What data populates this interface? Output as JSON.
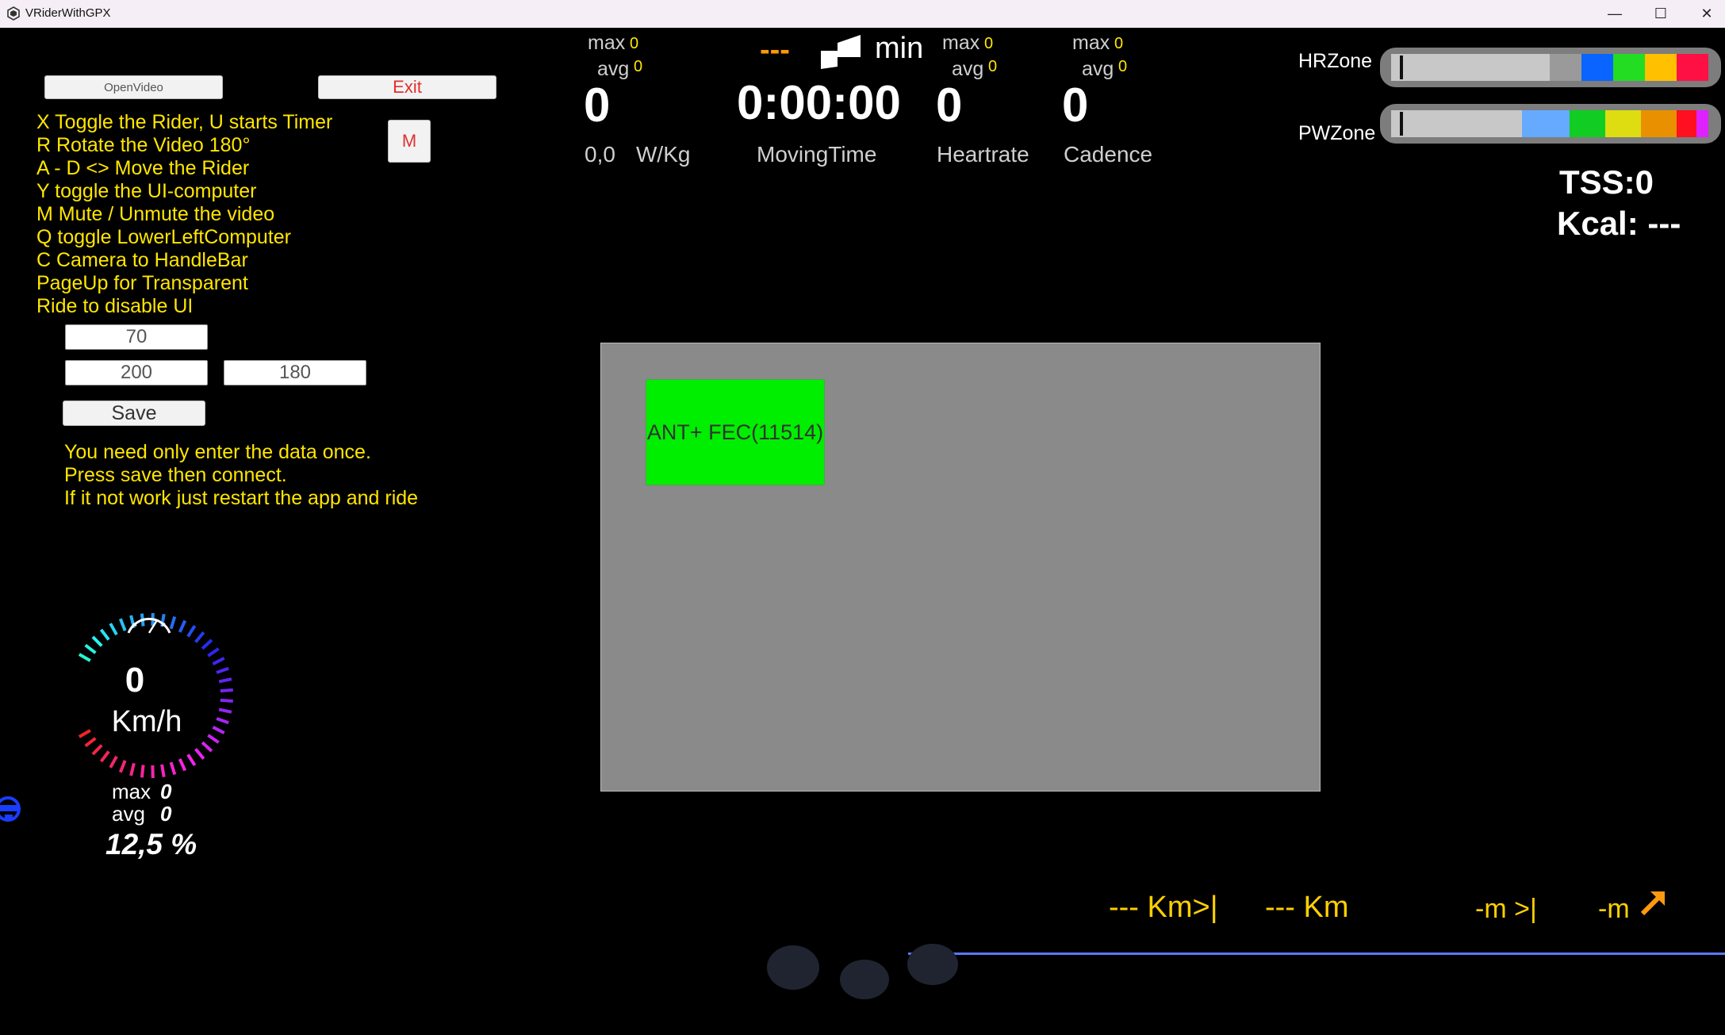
{
  "window": {
    "title": "VRiderWithGPX",
    "minimize_glyph": "—",
    "maximize_glyph": "☐",
    "close_glyph": "✕"
  },
  "controls": {
    "open_video_label": "OpenVideo",
    "exit_label": "Exit",
    "mute_label": "M",
    "save_label": "Save"
  },
  "help_lines": [
    "X Toggle the Rider, U starts Timer",
    "R Rotate the Video 180°",
    "A - D <> Move the Rider",
    "Y toggle the UI-computer",
    "M Mute / Unmute the video",
    "Q toggle LowerLeftComputer",
    "C Camera to HandleBar",
    "PageUp for Transparent",
    "Ride to disable UI"
  ],
  "inputs": {
    "field1": "70",
    "field2": "200",
    "field3": "180"
  },
  "info_lines": [
    "You need only enter the data once.",
    "Press save then connect.",
    "If it not work just restart the app and ride"
  ],
  "power": {
    "max_label": "max",
    "max_value": "0",
    "avg_label": "avg",
    "avg_value": "0",
    "value": "0",
    "wkg_value": "0,0",
    "wkg_unit": "W/Kg"
  },
  "time": {
    "dashes": "---",
    "unit": "min",
    "value": "0:00:00",
    "caption": "MovingTime"
  },
  "heartrate": {
    "max_label": "max",
    "max_value": "0",
    "avg_label": "avg",
    "avg_value": "0",
    "value": "0",
    "caption": "Heartrate"
  },
  "cadence": {
    "max_label": "max",
    "max_value": "0",
    "avg_label": "avg",
    "avg_value": "0",
    "value": "0",
    "caption": "Cadence"
  },
  "zones": {
    "hr_label": "HRZone",
    "pw_label": "PWZone",
    "hr_colors": [
      "#c8c8c8",
      "#9a9a9a",
      "#0a64ff",
      "#22dd22",
      "#ffc000",
      "#ff1044"
    ],
    "pw_colors": [
      "#c8c8c8",
      "#66aaff",
      "#11cc22",
      "#dddd11",
      "#e89000",
      "#ff1020",
      "#dd22ff"
    ]
  },
  "stats": {
    "tss_label": "TSS:",
    "tss_value": "0",
    "kcal_label": "Kcal:",
    "kcal_value": "---"
  },
  "device": {
    "button_label": "ANT+ FEC(11514)"
  },
  "speedo": {
    "value": "0",
    "unit": "Km/h",
    "max_label": "max",
    "max_value": "0",
    "avg_label": "avg",
    "avg_value": "0",
    "grade": "12,5 %"
  },
  "bottom": {
    "dist_to_end": "--- Km>|",
    "distance": "--- Km",
    "m_to_end": "-m >|",
    "elevation": "-m"
  }
}
